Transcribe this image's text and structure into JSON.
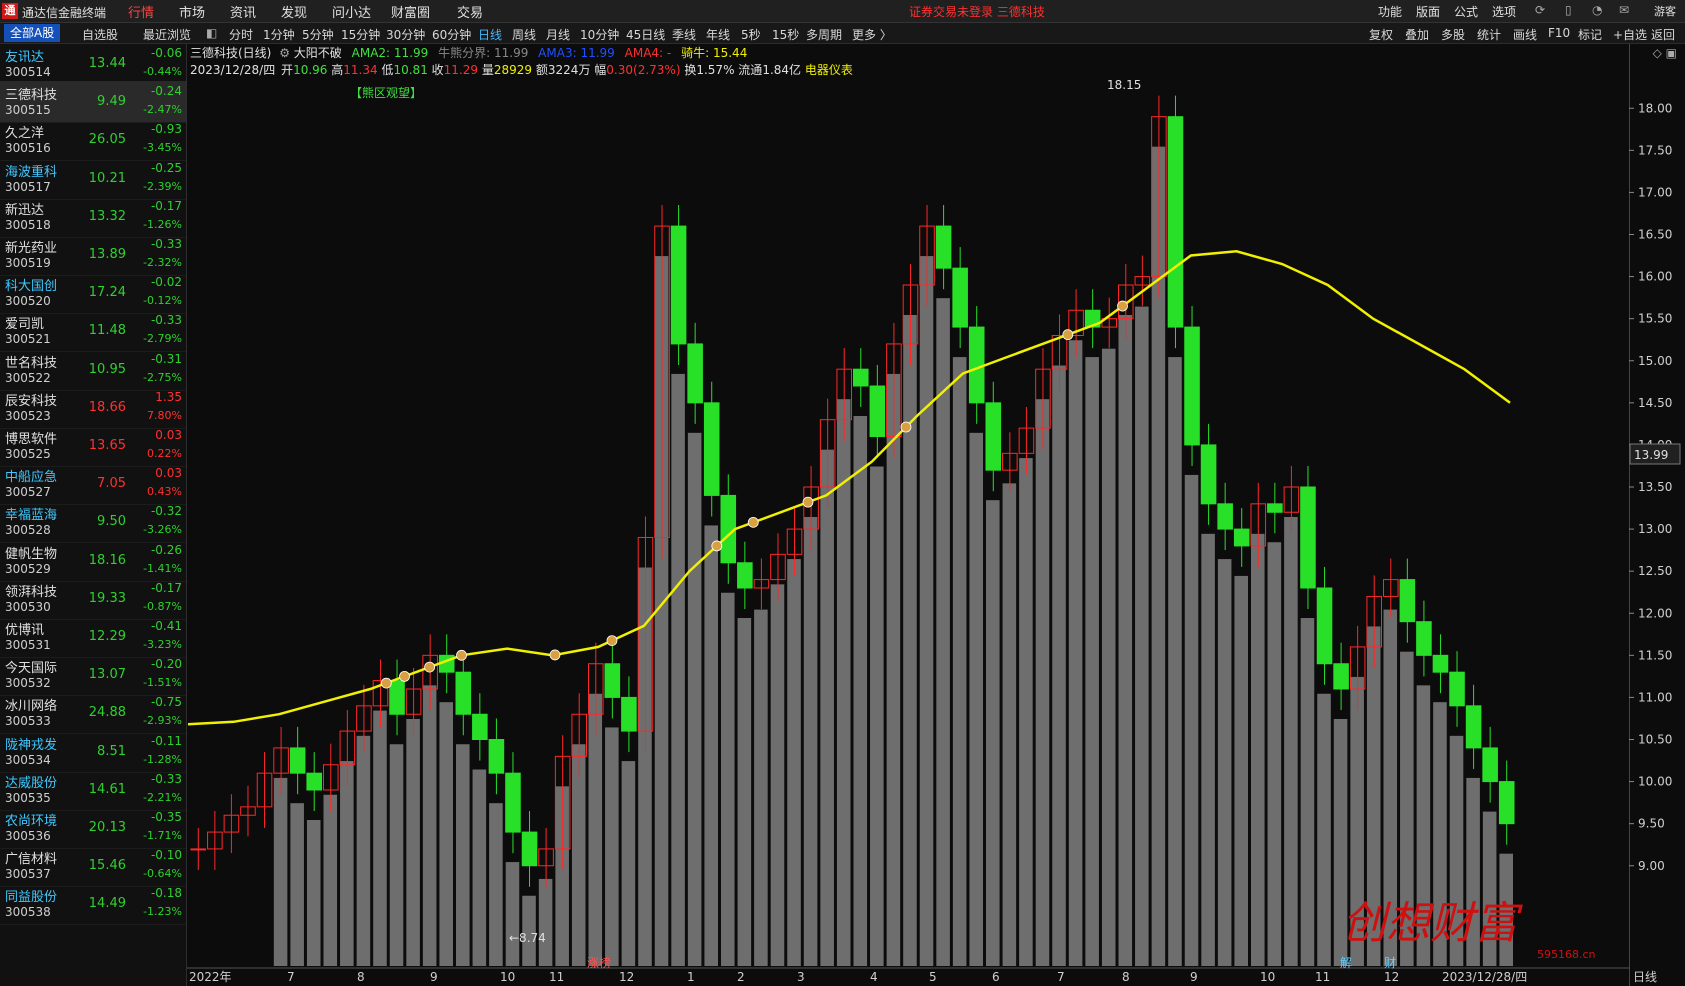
{
  "app": {
    "logo": "通",
    "title": "通达信金融终端"
  },
  "menu": [
    "行情",
    "市场",
    "资讯",
    "发现",
    "问小达",
    "财富圈",
    "交易"
  ],
  "menu_active": "行情",
  "login_status": "证券交易未登录  三德科技",
  "top_right": [
    "功能",
    "版面",
    "公式",
    "选项"
  ],
  "guest_label": "游客",
  "left_tabs": [
    "全部A股",
    "自选股",
    "最近浏览"
  ],
  "period_tabs": [
    "分时",
    "1分钟",
    "5分钟",
    "15分钟",
    "30分钟",
    "60分钟",
    "日线",
    "周线",
    "月线",
    "10分钟",
    "45日线",
    "季线",
    "年线",
    "5秒",
    "15秒",
    "多周期",
    "更多 〉"
  ],
  "period_active": "日线",
  "right_tools": [
    "复权",
    "叠加",
    "多股",
    "统计",
    "画线",
    "F10",
    "标记",
    "+自选",
    "返回"
  ],
  "stocks": [
    {
      "name": "友讯达",
      "code": "300514",
      "price": "13.44",
      "chg": "-0.06",
      "pct": "-0.44%",
      "up": false,
      "hl": true
    },
    {
      "name": "三德科技",
      "code": "300515",
      "price": "9.49",
      "chg": "-0.24",
      "pct": "-2.47%",
      "up": false,
      "hl": false,
      "sel": true
    },
    {
      "name": "久之洋",
      "code": "300516",
      "price": "26.05",
      "chg": "-0.93",
      "pct": "-3.45%",
      "up": false,
      "hl": false
    },
    {
      "name": "海波重科",
      "code": "300517",
      "price": "10.21",
      "chg": "-0.25",
      "pct": "-2.39%",
      "up": false,
      "hl": true
    },
    {
      "name": "新迅达",
      "code": "300518",
      "price": "13.32",
      "chg": "-0.17",
      "pct": "-1.26%",
      "up": false,
      "hl": false
    },
    {
      "name": "新光药业",
      "code": "300519",
      "price": "13.89",
      "chg": "-0.33",
      "pct": "-2.32%",
      "up": false,
      "hl": false
    },
    {
      "name": "科大国创",
      "code": "300520",
      "price": "17.24",
      "chg": "-0.02",
      "pct": "-0.12%",
      "up": false,
      "hl": true
    },
    {
      "name": "爱司凯",
      "code": "300521",
      "price": "11.48",
      "chg": "-0.33",
      "pct": "-2.79%",
      "up": false,
      "hl": false
    },
    {
      "name": "世名科技",
      "code": "300522",
      "price": "10.95",
      "chg": "-0.31",
      "pct": "-2.75%",
      "up": false,
      "hl": false
    },
    {
      "name": "辰安科技",
      "code": "300523",
      "price": "18.66",
      "chg": "1.35",
      "pct": "7.80%",
      "up": true,
      "hl": false
    },
    {
      "name": "博思软件",
      "code": "300525",
      "price": "13.65",
      "chg": "0.03",
      "pct": "0.22%",
      "up": true,
      "hl": false
    },
    {
      "name": "中船应急",
      "code": "300527",
      "price": "7.05",
      "chg": "0.03",
      "pct": "0.43%",
      "up": true,
      "hl": true
    },
    {
      "name": "幸福蓝海",
      "code": "300528",
      "price": "9.50",
      "chg": "-0.32",
      "pct": "-3.26%",
      "up": false,
      "hl": true
    },
    {
      "name": "健帆生物",
      "code": "300529",
      "price": "18.16",
      "chg": "-0.26",
      "pct": "-1.41%",
      "up": false,
      "hl": false
    },
    {
      "name": "领湃科技",
      "code": "300530",
      "price": "19.33",
      "chg": "-0.17",
      "pct": "-0.87%",
      "up": false,
      "hl": false
    },
    {
      "name": "优博讯",
      "code": "300531",
      "price": "12.29",
      "chg": "-0.41",
      "pct": "-3.23%",
      "up": false,
      "hl": false
    },
    {
      "name": "今天国际",
      "code": "300532",
      "price": "13.07",
      "chg": "-0.20",
      "pct": "-1.51%",
      "up": false,
      "hl": false
    },
    {
      "name": "冰川网络",
      "code": "300533",
      "price": "24.88",
      "chg": "-0.75",
      "pct": "-2.93%",
      "up": false,
      "hl": false
    },
    {
      "name": "陇神戎发",
      "code": "300534",
      "price": "8.51",
      "chg": "-0.11",
      "pct": "-1.28%",
      "up": false,
      "hl": true
    },
    {
      "name": "达威股份",
      "code": "300535",
      "price": "14.61",
      "chg": "-0.33",
      "pct": "-2.21%",
      "up": false,
      "hl": true
    },
    {
      "name": "农尚环境",
      "code": "300536",
      "price": "20.13",
      "chg": "-0.35",
      "pct": "-1.71%",
      "up": false,
      "hl": true
    },
    {
      "name": "广信材料",
      "code": "300537",
      "price": "15.46",
      "chg": "-0.10",
      "pct": "-0.64%",
      "up": false,
      "hl": false
    },
    {
      "name": "同益股份",
      "code": "300538",
      "price": "14.49",
      "chg": "-0.18",
      "pct": "-1.23%",
      "up": false,
      "hl": true
    }
  ],
  "info": {
    "title": "三德科技(日线)",
    "indicator": "大阳不破",
    "ama2_label": "AMA2:",
    "ama2": "11.99",
    "bull_label": "牛熊分界:",
    "bull": "11.99",
    "ama3_label": "AMA3:",
    "ama3": "11.99",
    "ama4_label": "AMA4:",
    "ama4": "-",
    "ride_label": "骑牛:",
    "ride": "15.44",
    "date": "2023/12/28/四",
    "open_label": "开",
    "open": "10.96",
    "high_label": "高",
    "high": "11.34",
    "low_label": "低",
    "low": "10.81",
    "close_label": "收",
    "close": "11.29",
    "vol_label": "量",
    "vol": "28929",
    "amt_label": "额",
    "amt": "3224万",
    "amp_label": "幅",
    "amp": "0.30(2.73%)",
    "turn_label": "换",
    "turn": "1.57%",
    "float_label": "流通",
    "float": "1.84亿",
    "industry": "电器仪表"
  },
  "chart_data": {
    "type": "candlestick",
    "title": "三德科技(日线)",
    "ylim": [
      8.7,
      18.3
    ],
    "yticks": [
      "18.00",
      "17.50",
      "17.00",
      "16.50",
      "16.00",
      "15.50",
      "15.00",
      "14.50",
      "14.00",
      "13.50",
      "13.00",
      "12.50",
      "12.00",
      "11.50",
      "11.00",
      "10.50",
      "10.00",
      "9.50",
      "9.00"
    ],
    "xticks": [
      "2022年",
      "7",
      "8",
      "9",
      "10",
      "11",
      "12",
      "1",
      "2",
      "3",
      "4",
      "5",
      "6",
      "7",
      "8",
      "9",
      "10",
      "11",
      "12",
      "2023/12/28/四",
      "日线"
    ],
    "annotations": {
      "zone": "【熊区观望】",
      "high_mark": "18.15",
      "low_mark": "←8.74",
      "current_price": "13.99",
      "event_1": "涨榜",
      "event_2": "解",
      "event_3": "财"
    },
    "yellow_line": [
      10.68,
      10.71,
      10.8,
      10.95,
      11.1,
      11.3,
      11.5,
      11.58,
      11.5,
      11.6,
      11.85,
      12.5,
      13.0,
      13.2,
      13.4,
      13.8,
      14.35,
      14.85,
      15.05,
      15.25,
      15.45,
      15.85,
      16.25,
      16.3,
      16.15,
      15.9,
      15.5,
      15.2,
      14.9,
      14.5
    ],
    "series_daily_close": [
      9.2,
      9.4,
      9.6,
      9.7,
      10.1,
      10.4,
      10.1,
      9.9,
      10.2,
      10.6,
      10.9,
      11.2,
      10.8,
      11.1,
      11.5,
      11.3,
      10.8,
      10.5,
      10.1,
      9.4,
      9.0,
      9.2,
      10.3,
      10.8,
      11.4,
      11.0,
      10.6,
      12.9,
      16.6,
      15.2,
      14.5,
      13.4,
      12.6,
      12.3,
      12.4,
      12.7,
      13.0,
      13.5,
      14.3,
      14.9,
      14.7,
      14.1,
      15.2,
      15.9,
      16.6,
      16.1,
      15.4,
      14.5,
      13.7,
      13.9,
      14.2,
      14.9,
      15.3,
      15.6,
      15.4,
      15.5,
      15.9,
      16.0,
      17.9,
      15.4,
      14.0,
      13.3,
      13.0,
      12.8,
      13.3,
      13.2,
      13.5,
      12.3,
      11.4,
      11.1,
      11.6,
      12.2,
      12.4,
      11.9,
      11.5,
      11.3,
      10.9,
      10.4,
      10.0,
      9.5
    ]
  },
  "watermark": {
    "text": "创想财富",
    "site": "595168.cn"
  }
}
